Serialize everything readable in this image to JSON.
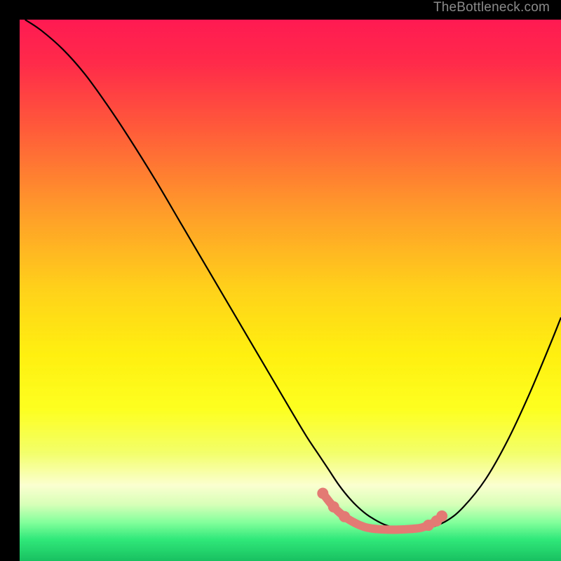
{
  "watermark": "TheBottleneck.com",
  "chart_data": {
    "type": "line",
    "title": "",
    "xlabel": "",
    "ylabel": "",
    "xlim": [
      0,
      100
    ],
    "ylim": [
      0,
      100
    ],
    "background_gradient": {
      "stops": [
        {
          "offset": 0.0,
          "color": "#ff1a52"
        },
        {
          "offset": 0.08,
          "color": "#ff2a4a"
        },
        {
          "offset": 0.2,
          "color": "#ff5a3a"
        },
        {
          "offset": 0.35,
          "color": "#ff9a2a"
        },
        {
          "offset": 0.5,
          "color": "#ffd21a"
        },
        {
          "offset": 0.62,
          "color": "#fff010"
        },
        {
          "offset": 0.72,
          "color": "#fdff20"
        },
        {
          "offset": 0.8,
          "color": "#f3ff6a"
        },
        {
          "offset": 0.86,
          "color": "#fbffd0"
        },
        {
          "offset": 0.895,
          "color": "#d8ffb8"
        },
        {
          "offset": 0.93,
          "color": "#7fff9a"
        },
        {
          "offset": 0.96,
          "color": "#30e87a"
        },
        {
          "offset": 1.0,
          "color": "#18c060"
        }
      ]
    },
    "series": [
      {
        "name": "bottleneck-curve",
        "color": "#000000",
        "x": [
          1,
          4,
          8,
          12,
          16,
          20,
          25,
          30,
          35,
          40,
          45,
          50,
          53,
          55,
          57,
          59,
          61,
          63,
          65,
          68,
          72,
          74,
          76,
          79,
          82,
          86,
          90,
          94,
          98,
          100
        ],
        "y": [
          100,
          98,
          94.5,
          90,
          84.5,
          78.5,
          70.5,
          62,
          53.5,
          45,
          36.5,
          28,
          23,
          20,
          17,
          14,
          11.5,
          9.5,
          8,
          6.5,
          5.8,
          5.8,
          6.2,
          7.5,
          10,
          15,
          22,
          30.5,
          40,
          45
        ]
      }
    ],
    "highlight_segment": {
      "name": "optimal-range",
      "color": "#e47a74",
      "x_range": [
        55,
        78
      ],
      "points": [
        {
          "x": 56,
          "y": 12.5
        },
        {
          "x": 58,
          "y": 10
        },
        {
          "x": 60,
          "y": 8.2
        },
        {
          "x": 62,
          "y": 7.0
        },
        {
          "x": 64,
          "y": 6.2
        },
        {
          "x": 66,
          "y": 5.9
        },
        {
          "x": 68,
          "y": 5.8
        },
        {
          "x": 70,
          "y": 5.8
        },
        {
          "x": 72,
          "y": 5.9
        },
        {
          "x": 74,
          "y": 6.1
        },
        {
          "x": 75.5,
          "y": 6.6
        },
        {
          "x": 77,
          "y": 7.4
        },
        {
          "x": 78,
          "y": 8.3
        }
      ]
    }
  }
}
